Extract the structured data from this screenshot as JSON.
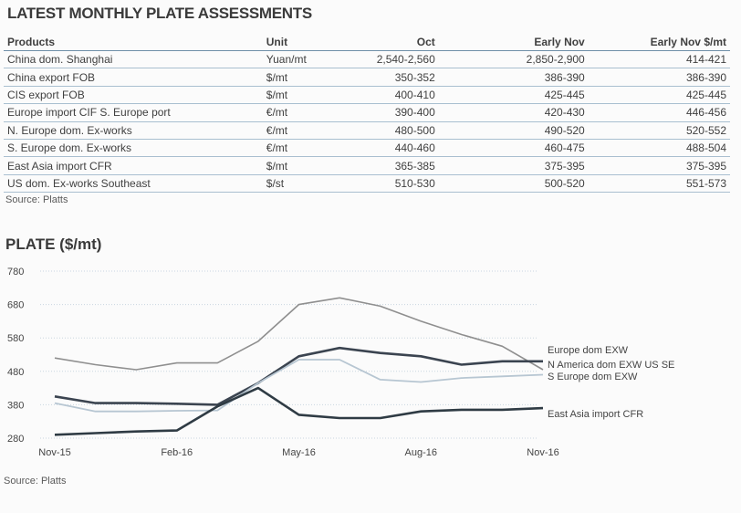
{
  "table": {
    "title": "LATEST MONTHLY PLATE ASSESSMENTS",
    "headers": [
      "Products",
      "Unit",
      "Oct",
      "Early Nov",
      "Early Nov $/mt"
    ],
    "rows": [
      [
        "China dom. Shanghai",
        "Yuan/mt",
        "2,540-2,560",
        "2,850-2,900",
        "414-421"
      ],
      [
        "China export FOB",
        "$/mt",
        "350-352",
        "386-390",
        "386-390"
      ],
      [
        "CIS export FOB",
        "$/mt",
        "400-410",
        "425-445",
        "425-445"
      ],
      [
        "Europe import CIF S. Europe port",
        "€/mt",
        "390-400",
        "420-430",
        "446-456"
      ],
      [
        "N. Europe dom. Ex-works",
        "€/mt",
        "480-500",
        "490-520",
        "520-552"
      ],
      [
        "S. Europe dom. Ex-works",
        "€/mt",
        "440-460",
        "460-475",
        "488-504"
      ],
      [
        "East Asia import CFR",
        "$/mt",
        "365-385",
        "375-395",
        "375-395"
      ],
      [
        "US dom. Ex-works Southeast",
        "$/st",
        "510-530",
        "500-520",
        "551-573"
      ]
    ],
    "source": "Source: Platts"
  },
  "chart_data": {
    "type": "line",
    "title": "PLATE ($/mt)",
    "x": [
      "Nov-15",
      "Dec-15",
      "Jan-16",
      "Feb-16",
      "Mar-16",
      "Apr-16",
      "May-16",
      "Jun-16",
      "Jul-16",
      "Aug-16",
      "Sep-16",
      "Oct-16",
      "Nov-16"
    ],
    "x_tick_labels": [
      "Nov-15",
      "Feb-16",
      "May-16",
      "Aug-16",
      "Nov-16"
    ],
    "y_ticks": [
      280,
      380,
      480,
      580,
      680,
      780
    ],
    "ylim": [
      280,
      780
    ],
    "grid": "horizontal",
    "legend_placement": "right, beside line ends",
    "series": [
      {
        "name": "Europe dom EXW",
        "color": "#8f8f8f",
        "values": [
          520,
          500,
          485,
          505,
          505,
          570,
          680,
          700,
          675,
          630,
          590,
          555,
          485
        ]
      },
      {
        "name": "N America dom EXW US SE",
        "color": "#3b4450",
        "values": [
          405,
          385,
          385,
          383,
          380,
          445,
          525,
          550,
          535,
          525,
          500,
          510,
          510
        ]
      },
      {
        "name": "S Europe dom EXW",
        "color": "#b7c6d2",
        "values": [
          385,
          360,
          360,
          362,
          363,
          445,
          515,
          515,
          455,
          448,
          460,
          465,
          470
        ]
      },
      {
        "name": "East Asia import CFR",
        "color": "#2f3b44",
        "values": [
          290,
          295,
          300,
          303,
          375,
          430,
          350,
          340,
          340,
          360,
          365,
          365,
          370
        ]
      }
    ],
    "source": "Source: Platts"
  }
}
